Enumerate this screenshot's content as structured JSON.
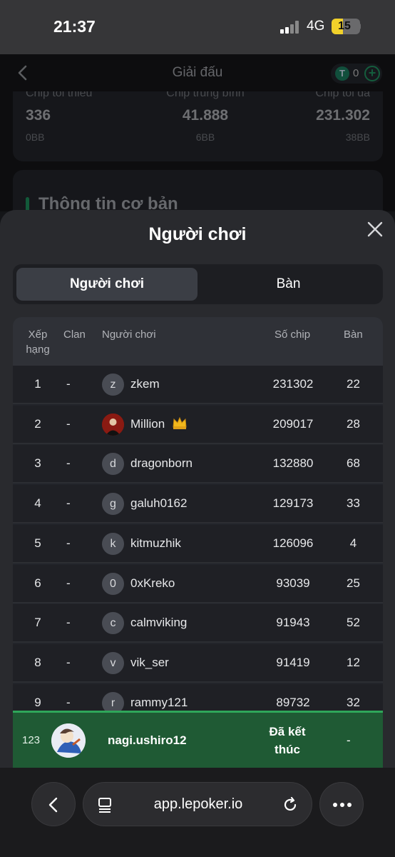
{
  "status_bar": {
    "time": "21:37",
    "network": "4G",
    "battery": "15",
    "battery_level": 0.15
  },
  "app": {
    "title": "Giải đấu",
    "coin_balance": "0",
    "chips": [
      {
        "label": "Chip tối thiểu",
        "value": "336",
        "bb": "0BB"
      },
      {
        "label": "Chip trung bình",
        "value": "41.888",
        "bb": "6BB"
      },
      {
        "label": "Chip tối đa",
        "value": "231.302",
        "bb": "38BB"
      }
    ],
    "info_title": "Thông tin cơ bản"
  },
  "sheet": {
    "title": "Người chơi",
    "tabs": [
      {
        "label": "Người chơi",
        "active": true
      },
      {
        "label": "Bàn",
        "active": false
      }
    ],
    "columns": {
      "rank": "Xếp hạng",
      "clan": "Clan",
      "player": "Người chơi",
      "chips": "Số chip",
      "table": "Bàn"
    },
    "rows": [
      {
        "rank": "1",
        "clan": "-",
        "initial": "z",
        "name": "zkem",
        "chips": "231302",
        "table": "22"
      },
      {
        "rank": "2",
        "clan": "-",
        "initial": "",
        "name": "Million",
        "chips": "209017",
        "table": "28",
        "photo": true,
        "crown": true
      },
      {
        "rank": "3",
        "clan": "-",
        "initial": "d",
        "name": "dragonborn",
        "chips": "132880",
        "table": "68"
      },
      {
        "rank": "4",
        "clan": "-",
        "initial": "g",
        "name": "galuh0162",
        "chips": "129173",
        "table": "33"
      },
      {
        "rank": "5",
        "clan": "-",
        "initial": "k",
        "name": "kitmuzhik",
        "chips": "126096",
        "table": "4"
      },
      {
        "rank": "6",
        "clan": "-",
        "initial": "0",
        "name": "0xKreko",
        "chips": "93039",
        "table": "25"
      },
      {
        "rank": "7",
        "clan": "-",
        "initial": "c",
        "name": "calmviking",
        "chips": "91943",
        "table": "52"
      },
      {
        "rank": "8",
        "clan": "-",
        "initial": "v",
        "name": "vik_ser",
        "chips": "91419",
        "table": "12"
      },
      {
        "rank": "9",
        "clan": "-",
        "initial": "r",
        "name": "rammy121",
        "chips": "89732",
        "table": "32"
      }
    ],
    "me": {
      "rank": "123",
      "name": "nagi.ushiro12",
      "status": "Đã kết thúc",
      "table": "-"
    }
  },
  "browser": {
    "url": "app.lepoker.io"
  },
  "colors": {
    "accent": "#1f8f5e",
    "my_row": "#1f5a34"
  }
}
